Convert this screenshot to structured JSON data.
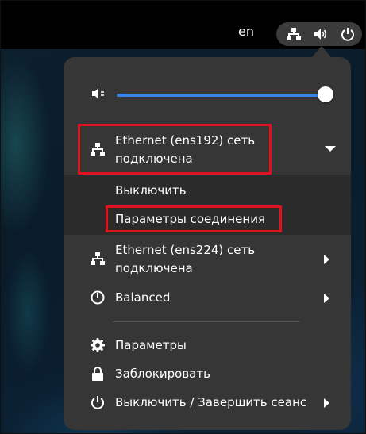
{
  "topbar": {
    "language": "en",
    "icons": [
      "network-wired-icon",
      "speaker-volume-icon",
      "power-icon"
    ]
  },
  "menu": {
    "volume": {
      "icon": "speaker-icon",
      "level": 1.0
    },
    "ethernet1": {
      "label_line1": "Ethernet (ens192) сеть",
      "label_line2": "подключена",
      "icon": "network-wired-icon",
      "expanded": true,
      "submenu": {
        "turn_off": "Выключить",
        "connection_settings": "Параметры соединения"
      }
    },
    "ethernet2": {
      "label_line1": "Ethernet (ens224) сеть",
      "label_line2": "подключена",
      "icon": "network-wired-icon"
    },
    "power_mode": {
      "label": "Balanced",
      "icon": "power-profile-icon"
    },
    "settings": {
      "label": "Параметры",
      "icon": "gear-icon"
    },
    "lock": {
      "label": "Заблокировать",
      "icon": "lock-icon"
    },
    "power_off": {
      "label": "Выключить / Завершить сеанс",
      "icon": "power-icon"
    }
  },
  "colors": {
    "accent": "#3584e4",
    "highlight": "#e0121f",
    "menu_bg": "#363636",
    "submenu_bg": "#2b2b2b"
  }
}
